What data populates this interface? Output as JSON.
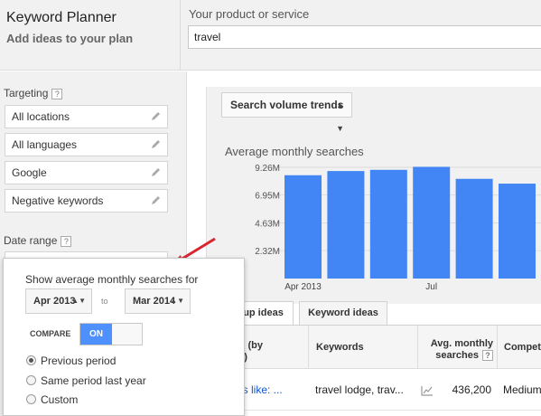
{
  "header": {
    "app_title": "Keyword Planner",
    "app_subtitle": "Add ideas to your plan",
    "product_label": "Your product or service",
    "product_value": "travel"
  },
  "targeting": {
    "label": "Targeting",
    "help": "?",
    "items": [
      {
        "label": "All locations",
        "icon": "pencil-icon"
      },
      {
        "label": "All languages",
        "icon": "pencil-icon"
      },
      {
        "label": "Google",
        "icon": "pencil-icon"
      },
      {
        "label": "Negative keywords",
        "icon": "pencil-icon"
      }
    ]
  },
  "date_range": {
    "label": "Date range",
    "help": "?"
  },
  "popup": {
    "title": "Show average monthly searches for",
    "from": "Apr 2013",
    "to_label": "to",
    "to": "Mar 2014",
    "compare_label": "COMPARE",
    "toggle_label": "ON",
    "options": [
      "Previous period",
      "Same period last year",
      "Custom"
    ],
    "selected_option": "Previous period"
  },
  "chart_panel": {
    "button_label": "Search volume trends",
    "title": "Average monthly searches"
  },
  "chart_data": {
    "type": "bar",
    "title": "Average monthly searches",
    "y_ticks": [
      "9.26M",
      "6.95M",
      "4.63M",
      "2.32M"
    ],
    "y_tick_values": [
      9260000,
      6950000,
      4630000,
      2320000
    ],
    "ylim": [
      0,
      9260000
    ],
    "x_labels": [
      {
        "label": "Apr 2013",
        "index": 0
      },
      {
        "label": "Jul",
        "index": 3
      }
    ],
    "values": [
      8600000,
      8950000,
      9050000,
      9300000,
      8300000,
      7900000
    ],
    "bar_color": "#4285f4",
    "grid": true
  },
  "tabs": [
    {
      "label": "up ideas",
      "active": true
    },
    {
      "label": "Keyword ideas",
      "active": false
    }
  ],
  "table": {
    "headers": {
      "group_line1": "up (by",
      "group_line2": "ce)",
      "keywords": "Keywords",
      "searches_line1": "Avg. monthly",
      "searches_line2": "searches",
      "searches_help": "?",
      "competition": "Compet"
    },
    "rows": [
      {
        "group": "rds like: ...",
        "keywords": "travel lodge, trav...",
        "trend_icon": "trend-chart-icon",
        "searches": "436,200",
        "competition": "Medium"
      }
    ]
  },
  "colors": {
    "accent": "#4d90fe",
    "bar": "#4285f4",
    "link": "#1155cc",
    "arrow": "#d8262e"
  }
}
